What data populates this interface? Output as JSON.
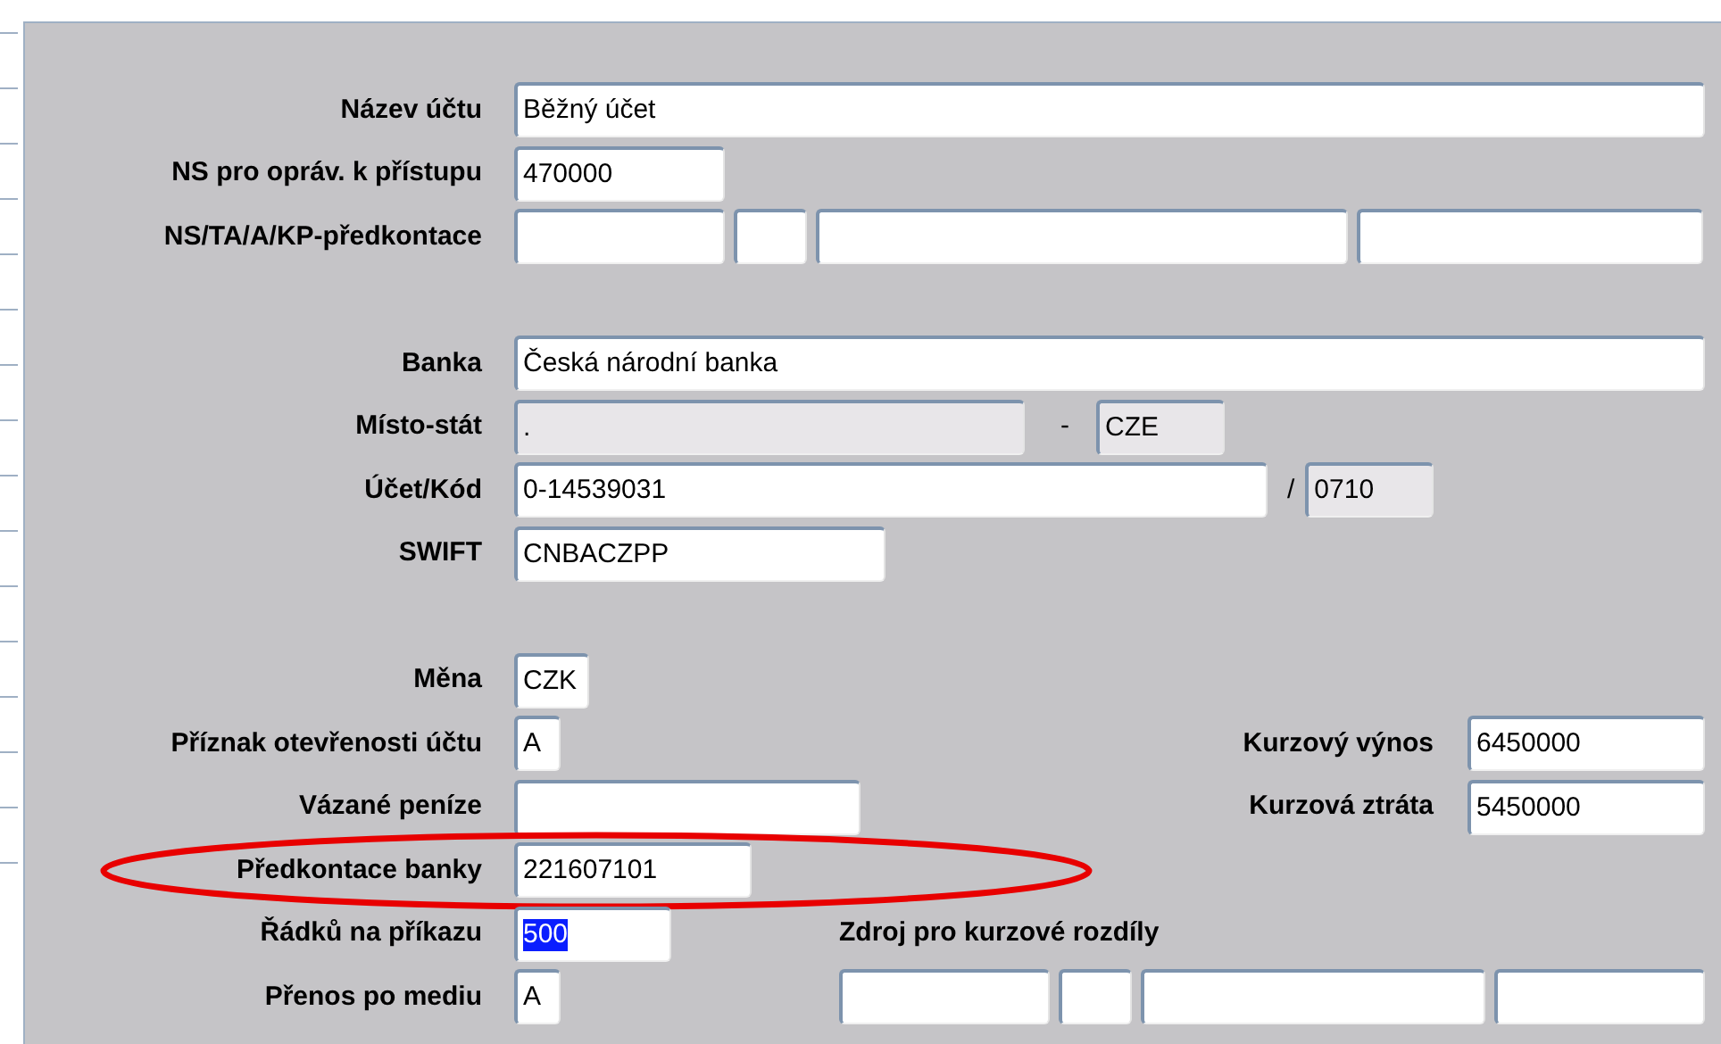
{
  "groups": [
    {
      "rows": [
        {
          "label": "Název účtu",
          "circled": false,
          "fields": [
            {
              "value": "Běžný účet",
              "disabled": false
            }
          ]
        },
        {
          "label": "NS pro opráv. k přístupu",
          "circled": false,
          "fields": [
            {
              "value": "470000",
              "disabled": false
            }
          ]
        },
        {
          "label": "NS/TA/A/KP-předkontace",
          "circled": false,
          "fields": [
            {
              "disabled": false
            },
            {
              "disabled": false
            },
            {
              "disabled": false
            },
            {
              "disabled": false
            }
          ]
        }
      ]
    },
    {
      "rows": [
        {
          "label": "Banka",
          "circled": false,
          "fields": [
            {
              "value": "Česká národní banka",
              "disabled": false
            }
          ]
        },
        {
          "label": "Místo-stát",
          "circled": false,
          "separator": "-",
          "fields": [
            {
              "value": ".",
              "disabled": true
            },
            {
              "value": "CZE",
              "disabled": true
            }
          ]
        },
        {
          "label": "Účet/Kód",
          "circled": false,
          "separator": "/",
          "fields": [
            {
              "value": "0-14539031",
              "disabled": false
            },
            {
              "value": "0710",
              "disabled": true
            }
          ]
        },
        {
          "label": "SWIFT",
          "circled": false,
          "fields": [
            {
              "value": "CNBACZPP",
              "disabled": false
            }
          ]
        }
      ]
    },
    {
      "rows": [
        {
          "label": "Měna",
          "circled": false,
          "fields": [
            {
              "value": "CZK",
              "disabled": false
            }
          ]
        },
        {
          "label": "Příznak otevřenosti účtu",
          "circled": false,
          "fields": [
            {
              "value": "A",
              "disabled": false
            }
          ],
          "right": {
            "kind": "field",
            "label": "Kurzový výnos",
            "fields": [
              {
                "value": "6450000",
                "disabled": false
              }
            ]
          }
        },
        {
          "label": "Vázané peníze",
          "circled": false,
          "fields": [
            {
              "disabled": false
            }
          ],
          "right": {
            "kind": "field",
            "label": "Kurzová ztráta",
            "fields": [
              {
                "value": "5450000",
                "disabled": false
              }
            ]
          }
        },
        {
          "label": "Předkontace banky",
          "circled": true,
          "fields": [
            {
              "value": "221607101",
              "disabled": false
            }
          ]
        },
        {
          "label": "Řádků na příkazu",
          "circled": false,
          "fields": [
            {
              "value": "500",
              "disabled": false,
              "text_selected": true
            }
          ],
          "right": {
            "kind": "heading",
            "label": "Zdroj pro kurzové rozdíly"
          }
        },
        {
          "label": "Přenos po mediu",
          "circled": false,
          "fields": [
            {
              "value": "A",
              "disabled": false
            }
          ],
          "right": {
            "kind": "fields",
            "fields": [
              {
                "disabled": false
              },
              {
                "disabled": false
              },
              {
                "disabled": false
              },
              {
                "disabled": false
              }
            ]
          }
        }
      ]
    }
  ]
}
